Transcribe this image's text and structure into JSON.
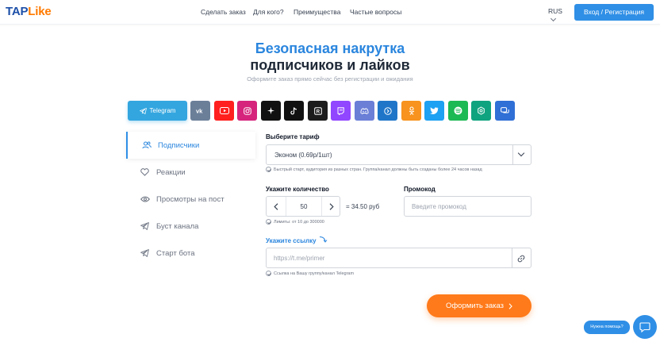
{
  "header": {
    "logo_a": "TAP",
    "logo_b": "Like",
    "nav": [
      "Сделать заказ",
      "Для кого?",
      "Преимущества",
      "Частые вопросы"
    ],
    "lang": "RUS",
    "login_label": "Вход / Регистрация"
  },
  "hero": {
    "title_line1": "Безопасная накрутка",
    "title_line2": "подписчиков и лайков",
    "subtitle": "Оформите заказ прямо сейчас без регистрации и ожидания"
  },
  "platforms": [
    {
      "name": "Telegram",
      "color": "#33a6df"
    },
    {
      "name": "vk",
      "color": "#6b7f99"
    },
    {
      "name": "youtube",
      "color": "#ff1f1f"
    },
    {
      "name": "instagram",
      "color": "#d6247c"
    },
    {
      "name": "x",
      "color": "#111111"
    },
    {
      "name": "tiktok",
      "color": "#111111"
    },
    {
      "name": "rutube",
      "color": "#1c1c1c"
    },
    {
      "name": "twitch",
      "color": "#9146ff"
    },
    {
      "name": "discord",
      "color": "#6b7fd7"
    },
    {
      "name": "likee",
      "color": "#1f76c9"
    },
    {
      "name": "odnoklassniki",
      "color": "#f7931e"
    },
    {
      "name": "twitter",
      "color": "#1da1f2"
    },
    {
      "name": "spotify",
      "color": "#1db954"
    },
    {
      "name": "chatgpt",
      "color": "#10a37f"
    },
    {
      "name": "messages",
      "color": "#2f6fd6"
    }
  ],
  "sidebar": {
    "items": [
      {
        "label": "Подписчики",
        "icon": "users-icon",
        "active": true
      },
      {
        "label": "Реакции",
        "icon": "heart-icon",
        "active": false
      },
      {
        "label": "Просмотры на пост",
        "icon": "eye-icon",
        "active": false
      },
      {
        "label": "Буст канала",
        "icon": "send-icon",
        "active": false
      },
      {
        "label": "Старт бота",
        "icon": "send-icon",
        "active": false
      }
    ]
  },
  "form": {
    "tariff_label": "Выберите тариф",
    "tariff_value": "Эконом (0.69р/1шт)",
    "tariff_hint": "Быстрый старт, аудитория из разных стран. Группа/канал должны быть созданы более 24 часов назад",
    "quantity_label": "Укажите количество",
    "quantity_value": "50",
    "price": "= 34.50 руб",
    "quantity_hint": "Лимиты: от 10 до 300000",
    "promo_label": "Промокод",
    "promo_placeholder": "Введите промокод",
    "link_label": "Укажите ссылку",
    "link_placeholder": "https://t.me/primer",
    "link_hint": "Ссылка на Вашу группу/канал Telegram",
    "submit_label": "Оформить заказ"
  },
  "help": {
    "bubble": "Нужна помощь?"
  },
  "colors": {
    "accent": "#2f8fe6",
    "cta": "#ff7a1a",
    "brand_dark": "#1d4fa8"
  }
}
